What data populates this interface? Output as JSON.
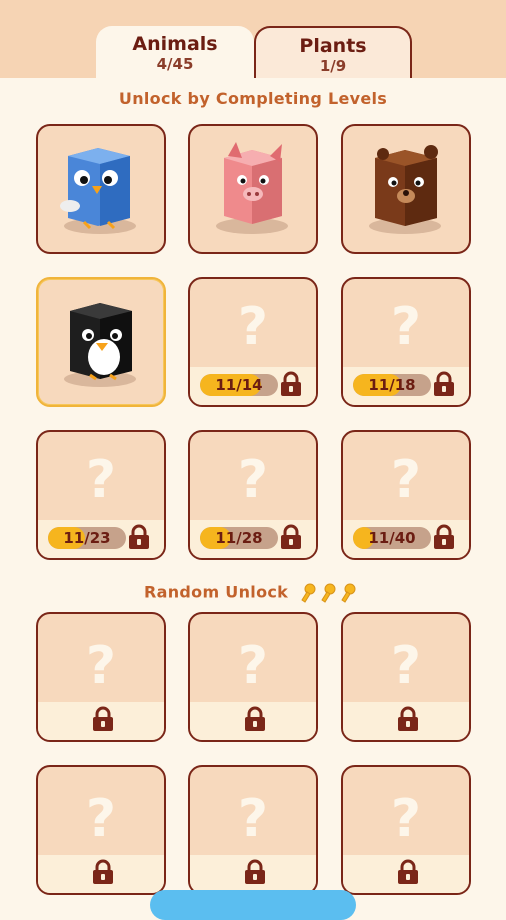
{
  "tabs": [
    {
      "label": "Animals",
      "count": "4/45",
      "active": true
    },
    {
      "label": "Plants",
      "count": "1/9",
      "active": false
    }
  ],
  "sections": {
    "levels_title": "Unlock by Completing Levels",
    "random_title": "Random Unlock"
  },
  "animals_unlocked": [
    {
      "name": "bluebird-cube",
      "color": "#4a86d8"
    },
    {
      "name": "pig-cube",
      "color": "#ef8a8c"
    },
    {
      "name": "bear-cube",
      "color": "#7a3a1a"
    },
    {
      "name": "penguin-cube",
      "color": "#1e1e1e"
    }
  ],
  "locked_by_level": [
    {
      "progress": "11/14",
      "fraction": 0.786
    },
    {
      "progress": "11/18",
      "fraction": 0.611
    },
    {
      "progress": "11/23",
      "fraction": 0.478
    },
    {
      "progress": "11/28",
      "fraction": 0.393
    },
    {
      "progress": "11/40",
      "fraction": 0.275
    }
  ],
  "question_mark": "?",
  "keys_count": 3,
  "colors": {
    "accent_text": "#c2622c",
    "border": "#7a2618",
    "progress_fill": "#f6b51e",
    "selected_border": "#f0b43a",
    "button": "#5bbef0"
  }
}
